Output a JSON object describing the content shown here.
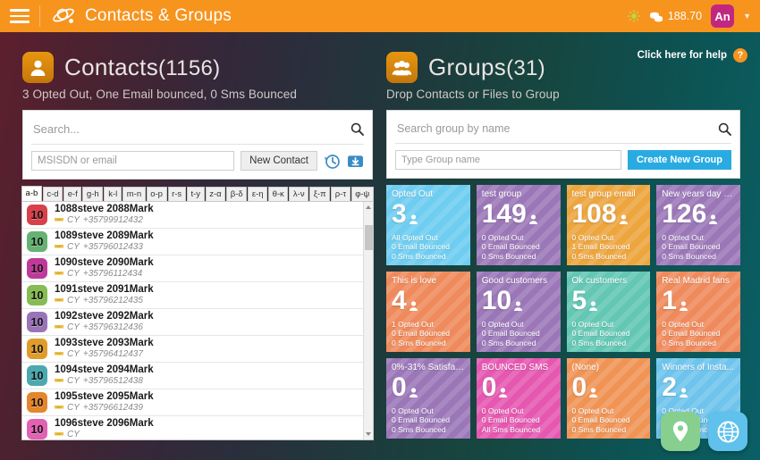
{
  "topbar": {
    "menu_icon": "hamburger-icon",
    "logo_icon": "planet-orbit-logo",
    "title": "Contacts & Groups",
    "sun_icon": "sun-icon",
    "coins_icon": "coins-icon",
    "balance": "188.70",
    "avatar_label": "An",
    "caret_icon": "chevron-down-icon"
  },
  "contacts": {
    "icon": "person-icon",
    "title": "Contacts",
    "count": "(1156)",
    "subtitle": "3 Opted Out, One Email bounced, 0 Sms Bounced",
    "search_placeholder": "Search...",
    "search_value": "",
    "search_icon": "search-icon",
    "msisdn_placeholder": "MSISDN or email",
    "msisdn_value": "",
    "new_contact_label": "New Contact",
    "history_icon": "history-clock-icon",
    "import_icon": "import-download-icon",
    "alpha_tabs": [
      {
        "label": "a-b",
        "active": true
      },
      {
        "label": "c-d",
        "active": false
      },
      {
        "label": "e-f",
        "active": false
      },
      {
        "label": "g-h",
        "active": false
      },
      {
        "label": "k-l",
        "active": false
      },
      {
        "label": "m-n",
        "active": false
      },
      {
        "label": "o-p",
        "active": false
      },
      {
        "label": "r-s",
        "active": false
      },
      {
        "label": "t-y",
        "active": false
      },
      {
        "label": "z-α",
        "active": false
      },
      {
        "label": "β-δ",
        "active": false
      },
      {
        "label": "ε-η",
        "active": false
      },
      {
        "label": "θ-κ",
        "active": false
      },
      {
        "label": "λ-ν",
        "active": false
      },
      {
        "label": "ξ-π",
        "active": false
      },
      {
        "label": "ρ-τ",
        "active": false
      },
      {
        "label": "φ-ψ",
        "active": false
      }
    ],
    "rows": [
      {
        "badge": "10",
        "badge_color": "#d8414a",
        "name": "1088steve 2088Mark",
        "country": "CY",
        "phone": "+35799912432"
      },
      {
        "badge": "10",
        "badge_color": "#65b273",
        "name": "1089steve 2089Mark",
        "country": "CY",
        "phone": "+35796012433"
      },
      {
        "badge": "10",
        "badge_color": "#c0399a",
        "name": "1090steve 2090Mark",
        "country": "CY",
        "phone": "+35796112434"
      },
      {
        "badge": "10",
        "badge_color": "#87bb53",
        "name": "1091steve 2091Mark",
        "country": "CY",
        "phone": "+35796212435"
      },
      {
        "badge": "10",
        "badge_color": "#9b73b8",
        "name": "1092steve 2092Mark",
        "country": "CY",
        "phone": "+35796312436"
      },
      {
        "badge": "10",
        "badge_color": "#e09c2a",
        "name": "1093steve 2093Mark",
        "country": "CY",
        "phone": "+35796412437"
      },
      {
        "badge": "10",
        "badge_color": "#4aa9ae",
        "name": "1094steve 2094Mark",
        "country": "CY",
        "phone": "+35796512438"
      },
      {
        "badge": "10",
        "badge_color": "#e5862c",
        "name": "1095steve 2095Mark",
        "country": "CY",
        "phone": "+35796612439"
      },
      {
        "badge": "10",
        "badge_color": "#e261b4",
        "name": "1096steve 2096Mark",
        "country": "CY",
        "phone": ""
      }
    ]
  },
  "groups": {
    "icon": "people-group-icon",
    "title": "Groups",
    "count": "(31)",
    "subtitle": "Drop Contacts or Files to Group",
    "help_text": "Click here for help",
    "help_icon": "question-mark-icon",
    "search_placeholder": "Search group by name",
    "search_value": "",
    "search_icon": "search-icon",
    "name_placeholder": "Type Group name",
    "name_value": "",
    "create_label": "Create New Group",
    "tiles": [
      {
        "name": "Opted Out",
        "count": "3",
        "color": "#6ecdf0",
        "opted_out": "All Opted Out",
        "email_bounced": "0 Email Bounced",
        "sms_bounced": "0 Sms Bounced"
      },
      {
        "name": "test group",
        "count": "149",
        "color": "#9b77b8",
        "opted_out": "0 Opted Out",
        "email_bounced": "0 Email Bounced",
        "sms_bounced": "0 Sms Bounced"
      },
      {
        "name": "test group email",
        "count": "108",
        "color": "#eda53e",
        "opted_out": "0 Opted Out",
        "email_bounced": "1 Email Bounced",
        "sms_bounced": "0 Sms Bounced"
      },
      {
        "name": "New years day o...",
        "count": "126",
        "color": "#9b77b8",
        "opted_out": "0 Opted Out",
        "email_bounced": "0 Email Bounced",
        "sms_bounced": "0 Sms Bounced"
      },
      {
        "name": "This is love",
        "count": "4",
        "color": "#ef8a5c",
        "opted_out": "1 Opted Out",
        "email_bounced": "0 Email Bounced",
        "sms_bounced": "0 Sms Bounced"
      },
      {
        "name": "Good customers",
        "count": "10",
        "color": "#9b77b8",
        "opted_out": "0 Opted Out",
        "email_bounced": "0 Email Bounced",
        "sms_bounced": "0 Sms Bounced"
      },
      {
        "name": "Ok customers",
        "count": "5",
        "color": "#63c7b4",
        "opted_out": "0 Opted Out",
        "email_bounced": "0 Email Bounced",
        "sms_bounced": "0 Sms Bounced"
      },
      {
        "name": "Real Madrid fans",
        "count": "1",
        "color": "#ef8a5c",
        "opted_out": "0 Opted Out",
        "email_bounced": "0 Email Bounced",
        "sms_bounced": "0 Sms Bounced"
      },
      {
        "name": "0%-31% Satisfac...",
        "count": "0",
        "color": "#9b77b8",
        "opted_out": "0 Opted Out",
        "email_bounced": "0 Email Bounced",
        "sms_bounced": "0 Sms Bounced"
      },
      {
        "name": "BOUNCED SMS",
        "count": "0",
        "color": "#e557b0",
        "opted_out": "0 Opted Out",
        "email_bounced": "0 Email Bounced",
        "sms_bounced": "All Sms Bounced"
      },
      {
        "name": "(None)",
        "count": "0",
        "color": "#f09456",
        "opted_out": "0 Opted Out",
        "email_bounced": "0 Email Bounced",
        "sms_bounced": "0 Sms Bounced"
      },
      {
        "name": "Winners of Insta...",
        "count": "2",
        "color": "#6ec4ec",
        "opted_out": "0 Opted Out",
        "email_bounced": "0 Email Bounced",
        "sms_bounced": "0 Sms Bounced"
      }
    ]
  },
  "fabs": [
    {
      "icon": "location-pin-icon",
      "id": "fab-location"
    },
    {
      "icon": "globe-icon",
      "id": "fab-globe"
    }
  ]
}
